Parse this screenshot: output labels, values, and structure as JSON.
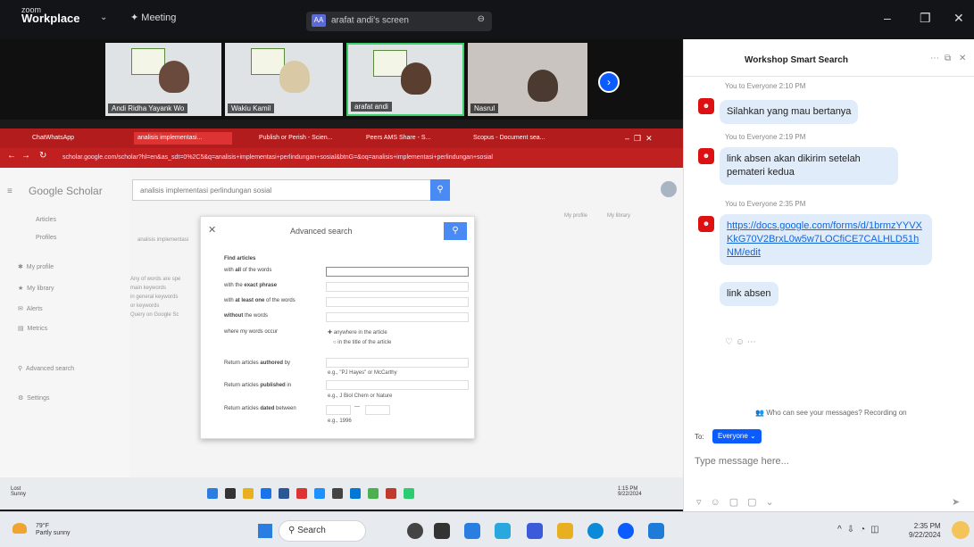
{
  "zoom": {
    "logo_top": "zoom",
    "logo_bottom": "Workplace",
    "meeting_label": "Meeting",
    "share_avatar": "AA",
    "share_label": "arafat andi's screen"
  },
  "participants": [
    {
      "name": "Andi Ridha Yayank Wo"
    },
    {
      "name": "Wakiu Kamil"
    },
    {
      "name": "arafat andi"
    },
    {
      "name": "Nasrul"
    }
  ],
  "browser": {
    "tabs": [
      "ChatWhatsApp",
      "analisis implementasi...",
      "Publish or Perish - Scien...",
      "Peers AMS Share - S...",
      "Scopus - Document sea..."
    ],
    "url": "scholar.google.com/scholar?hl=en&as_sdt=0%2C5&q=analisis+implementasi+perlindungan+sosial&btnG=&oq=analisis+implementasi+perlindungan+sosial"
  },
  "scholar": {
    "logo": "Google Scholar",
    "query": "analisis implementasi perlindungan sosial",
    "nav_items": [
      "Articles",
      "Profiles",
      "My profile",
      "My library",
      "Alerts",
      "Metrics",
      "Advanced search",
      "Settings"
    ],
    "top_links": [
      "My profile",
      "My library"
    ],
    "bg_result": "analisis implementasi",
    "bg_snips": [
      "Any of words are spe",
      "main keywords",
      "in general keywords",
      "or keywords",
      "Query on Google Sc"
    ]
  },
  "advanced": {
    "title": "Advanced search",
    "section": "Find articles",
    "rows": [
      {
        "pre": "with ",
        "strong": "all",
        "post": " of the words"
      },
      {
        "pre": "with the ",
        "strong": "exact phrase",
        "post": ""
      },
      {
        "pre": "with ",
        "strong": "at least one",
        "post": " of the words"
      },
      {
        "pre": "",
        "strong": "without",
        "post": " the words"
      }
    ],
    "where_label": "where my words occur",
    "radio1": "anywhere in the article",
    "radio2": "in the title of the article",
    "author_label_pre": "Return articles ",
    "author_label_strong": "authored",
    "author_label_post": " by",
    "author_hint": "e.g., \"PJ Hayes\" or McCarthy",
    "pub_label_pre": "Return articles ",
    "pub_label_strong": "published",
    "pub_label_post": " in",
    "pub_hint": "e.g., J Biol Chem or Nature",
    "date_label_pre": "Return articles ",
    "date_label_strong": "dated",
    "date_label_post": " between",
    "date_sep": "—",
    "date_hint": "e.g., 1996"
  },
  "inner_taskbar": {
    "weather": "Lost",
    "weather2": "Sunny",
    "time": "1:15 PM",
    "date": "9/22/2024"
  },
  "chat": {
    "title": "Workshop Smart Search",
    "messages": [
      {
        "meta": "You to Everyone 2:10 PM",
        "text": "Silahkan yang mau bertanya"
      },
      {
        "meta": "You to Everyone 2:19 PM",
        "text": "link absen akan dikirim setelah pemateri kedua"
      },
      {
        "meta": "You to Everyone 2:35 PM",
        "link": "https://docs.google.com/forms/d/1brmzYYVXKkG70V2BrxL0w5w7LOCfiCE7CALHLD51hNM/edit"
      },
      {
        "text": "link absen"
      }
    ],
    "who_can_see": "Who can see your messages? Recording on",
    "to_label": "To:",
    "everyone": "Everyone",
    "placeholder": "Type message here..."
  },
  "taskbar": {
    "weather_temp": "79°F",
    "weather_desc": "Partly sunny",
    "search": "Search",
    "time": "2:35 PM",
    "date": "9/22/2024"
  }
}
